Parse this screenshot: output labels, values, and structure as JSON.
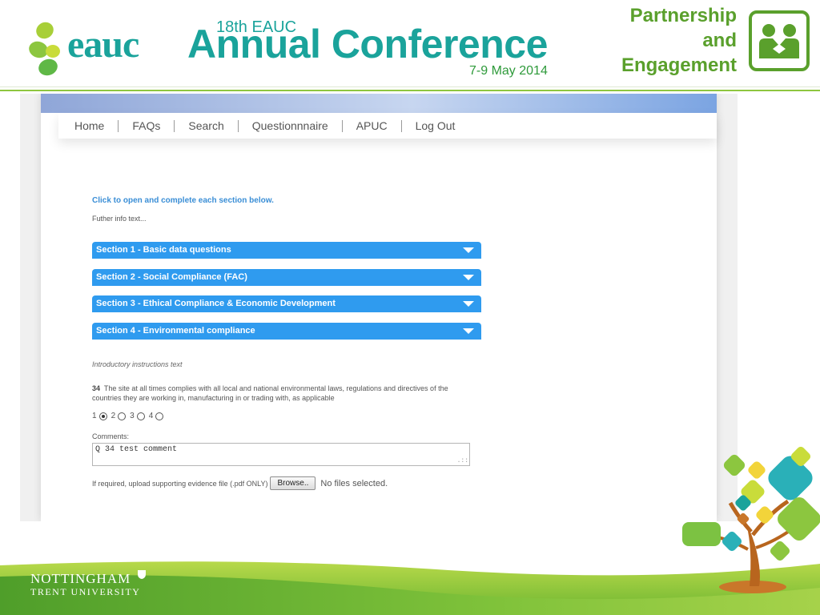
{
  "slide": {
    "logo_text": "eauc",
    "conference_edition": "18th EAUC",
    "conference_title": "Annual Conference",
    "conference_dates": "7-9 May 2014",
    "partnership_lines": [
      "Partnership",
      "and",
      "Engagement"
    ],
    "university_line1": "NOTTINGHAM",
    "university_line2": "TRENT UNIVERSITY",
    "colors": {
      "teal": "#1aa39b",
      "green": "#5aa02c",
      "accent_blue": "#2f9bef"
    }
  },
  "nav": {
    "items": [
      "Home",
      "FAQs",
      "Search",
      "Questionnnaire",
      "APUC",
      "Log Out"
    ]
  },
  "intro": {
    "link_text": "Click to open and complete each section below.",
    "further_info": "Futher info text..."
  },
  "sections": [
    {
      "label": "Section 1 - Basic data questions",
      "icon": "chevron-down-icon"
    },
    {
      "label": "Section 2 - Social Compliance (FAC)",
      "icon": "chevron-down-icon"
    },
    {
      "label": "Section 3 - Ethical Compliance & Economic Development",
      "icon": "chevron-down-icon"
    },
    {
      "label": "Section 4 - Environmental compliance",
      "icon": "chevron-down-icon"
    }
  ],
  "question": {
    "instructions": "Introductory instructions text",
    "number": "34",
    "text": "The site at all times complies with all local and national environmental laws, regulations and directives of the countries they are working in, manufacturing in or trading with, as applicable",
    "options": [
      "1",
      "2",
      "3",
      "4"
    ],
    "selected": "1",
    "comments_label": "Comments:",
    "comment_value": "Q 34 test comment"
  },
  "upload": {
    "label": "If required, upload supporting evidence file (.pdf ONLY)",
    "button_label": "Browse..",
    "status": "No files selected."
  }
}
